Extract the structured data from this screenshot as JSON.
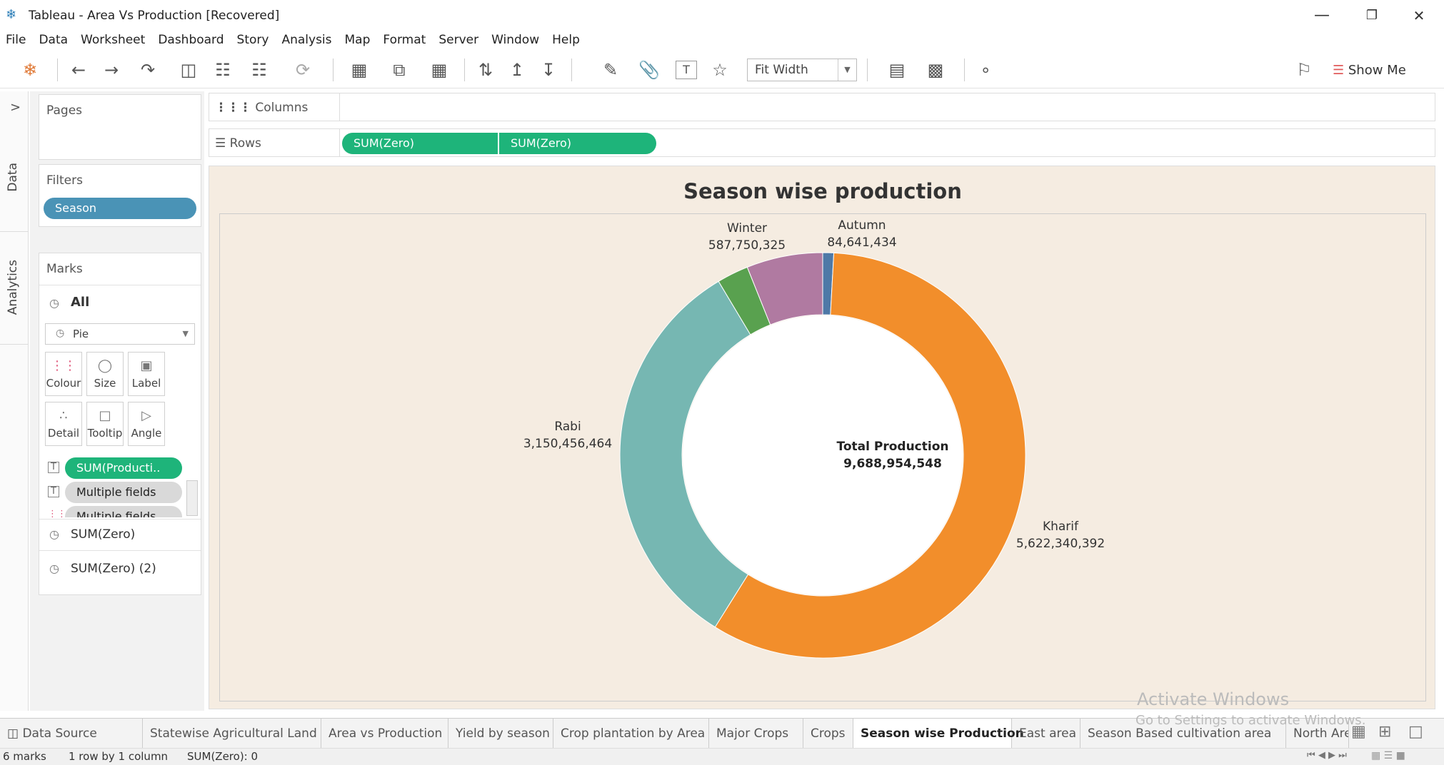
{
  "window": {
    "title": "Tableau - Area Vs Production [Recovered]",
    "minimize_glyph": "—",
    "restore_glyph": "❐",
    "close_glyph": "✕"
  },
  "menu": [
    "File",
    "Data",
    "Worksheet",
    "Dashboard",
    "Story",
    "Analysis",
    "Map",
    "Format",
    "Server",
    "Window",
    "Help"
  ],
  "toolbar": {
    "fit": "Fit Width",
    "show_me": "Show Me"
  },
  "sidetabs": {
    "data": "Data",
    "analytics": "Analytics",
    "collapse": ">"
  },
  "pages": {
    "title": "Pages"
  },
  "filters": {
    "title": "Filters",
    "pill": "Season"
  },
  "marks": {
    "title": "Marks",
    "all": "All",
    "type": "Pie",
    "buttons": [
      "Colour",
      "Size",
      "Label",
      "Detail",
      "Tooltip",
      "Angle"
    ],
    "fields": [
      "SUM(Producti..",
      "Multiple fields",
      "Multiple fields"
    ],
    "layers": [
      "SUM(Zero)",
      "SUM(Zero) (2)"
    ]
  },
  "shelves": {
    "columns": "Columns",
    "rows": "Rows",
    "row_pills": [
      "SUM(Zero)",
      "SUM(Zero)"
    ]
  },
  "colors": {
    "kharif": "#f28e2b",
    "rabi": "#76b7b2",
    "whole_year": "#59a14f",
    "winter": "#b07aa1",
    "autumn": "#4e79a7",
    "summer": "#e15759",
    "canvas": "#f5ece1",
    "accent": "#1eb47a"
  },
  "chart_data": {
    "type": "pie",
    "title": "Season wise production",
    "center_label": "Total Production",
    "center_value": "9,688,954,548",
    "total": 9688954548,
    "slices": [
      {
        "name": "Autumn",
        "value": 84641434,
        "label": "84,641,434",
        "color": "#4e79a7",
        "labeled": true
      },
      {
        "name": "Kharif",
        "value": 5622340392,
        "label": "5,622,340,392",
        "color": "#f28e2b",
        "labeled": true
      },
      {
        "name": "Rabi",
        "value": 3150456464,
        "label": "3,150,456,464",
        "color": "#76b7b2",
        "labeled": true
      },
      {
        "name": "",
        "value": 243766000,
        "label": "",
        "color": "#59a14f",
        "labeled": false
      },
      {
        "name": "Winter",
        "value": 587750325,
        "label": "587,750,325",
        "color": "#b07aa1",
        "labeled": true
      }
    ]
  },
  "watermark": {
    "line1": "Activate Windows",
    "line2": "Go to Settings to activate Windows."
  },
  "tabs": [
    "Data Source",
    "Statewise Agricultural Land",
    "Area vs Production",
    "Yield by season",
    "Crop plantation by Area",
    "Major Crops",
    "Crops",
    "Season wise Production",
    "East area",
    "Season Based cultivation area",
    "North Are"
  ],
  "active_tab": "Season wise Production",
  "status": {
    "marks": "6 marks",
    "dims": "1 row by 1 column",
    "sum": "SUM(Zero): 0"
  }
}
